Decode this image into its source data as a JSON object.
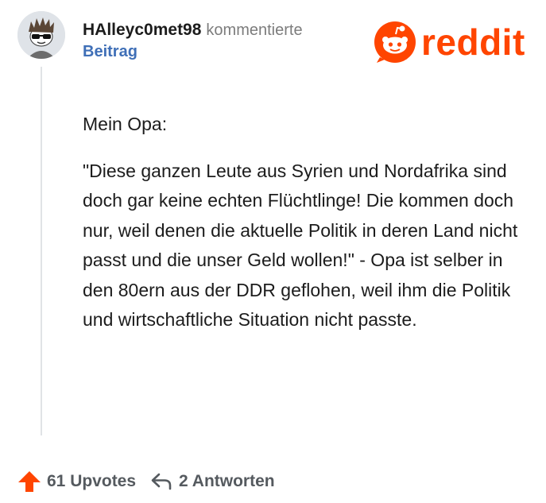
{
  "comment": {
    "username": "HAlleyc0met98",
    "action": "kommentierte",
    "post_link": "Beitrag",
    "intro": "Mein Opa:",
    "body": "\"Diese ganzen Leute aus Syrien und Nordafrika sind doch gar keine echten Flüchtlinge! Die kommen doch nur, weil denen die aktuelle Politik in deren Land nicht passt und die unser Geld wollen!\" - Opa ist selber in den 80ern aus der DDR geflohen, weil ihm die Politik und wirtschaftliche Situation nicht passte."
  },
  "brand": {
    "logo_text": "reddit",
    "color": "#ff4500"
  },
  "footer": {
    "upvotes_label": "61 Upvotes",
    "replies_label": "2 Antworten"
  },
  "icons": [
    "avatar",
    "reddit-snoo-icon",
    "upvote-arrow-icon",
    "reply-icon"
  ],
  "colors": {
    "link": "#3f6fb7",
    "upvote": "#ff4500",
    "muted": "#7c7c7c"
  }
}
